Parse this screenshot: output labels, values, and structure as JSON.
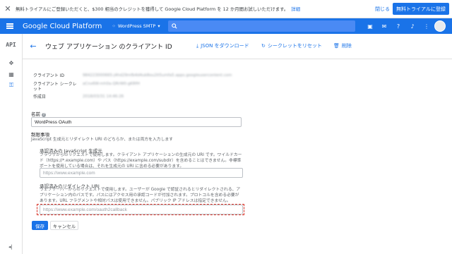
{
  "promo": {
    "message": "無料トライアルにご登録いただくと、$300 相当のクレジットを獲得して Google Cloud Platform を 12 か月間お試しいただけます。",
    "details_link": "詳細",
    "close_label": "閉じる",
    "trial_button": "無料トライアルに登録"
  },
  "topbar": {
    "brand": "Google Cloud Platform",
    "project": "WordPress SMTP",
    "search_placeholder": ""
  },
  "leftnav": {
    "api_label": "API"
  },
  "header": {
    "title": "ウェブ アプリケーション のクライアント ID",
    "download_json": "JSON をダウンロード",
    "reset_secret": "シークレットをリセット",
    "delete": "削除"
  },
  "client_info": {
    "client_id_label": "クライアント ID",
    "client_id_value": "984223000665-j4hd29mfb4d4uk8ou2it5umfa5.apps.googleusercontent.com",
    "client_secret_label": "クライアント シークレット",
    "client_secret_value": "aCnx6W-mh0a-QRrW0-gKRfH",
    "created_label": "作成日",
    "created_value": "2018/03/31 14:46:26"
  },
  "name_section": {
    "label": "名前",
    "value": "WordPress OAuth"
  },
  "restrictions": {
    "title": "制限事項",
    "description": "JavaScript 生成元とリダイレクト URI のどちらか、または両方を入力します",
    "js_origin_title": "承認済みの JavaScript 生成元",
    "js_origin_desc": "ブラウザからのリクエストで使用します。クライアント アプリケーションの生成元の URI です。ワイルドカード（https://*.example.com）や パス（https://example.com/subdir）を含めることはできません。非標準ポートを使用している場合は、それを生成元の URI に含める必要があります。",
    "js_origin_placeholder": "https://www.example.com",
    "redirect_title": "承認済みのリダイレクト URI",
    "redirect_desc": "ウェブサーバーからのリクエストで使用します。ユーザーが Google で認証されるとリダイレクトされる、アプリケーション内のパスです。パスにはアクセス用の承認コードが付加されます。プロトコルを含める必要があります。URL フラグメントや相対パスは使用できません。パブリック IP アドレスは指定できません。",
    "redirect_placeholder": "https://www.example.com/oauth2callback"
  },
  "actions": {
    "save": "保存",
    "cancel": "キャンセル"
  }
}
